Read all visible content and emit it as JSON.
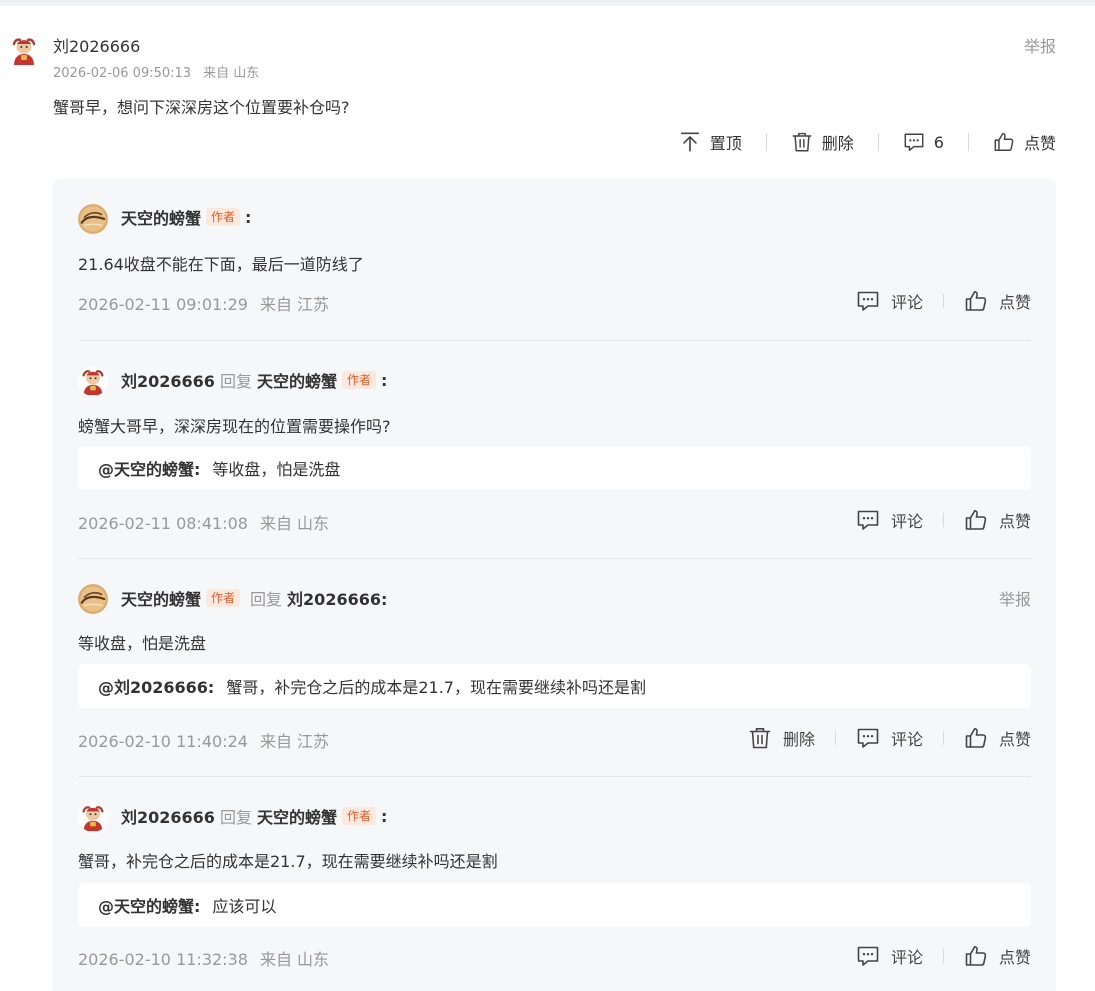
{
  "main": {
    "username": "刘2026666",
    "timestamp": "2026-02-06 09:50:13",
    "location": "来自 山东",
    "report_label": "举报",
    "content": "蟹哥早，想问下深深房这个位置要补仓吗?",
    "actions": {
      "pin_label": "置顶",
      "delete_label": "删除",
      "comment_count": "6",
      "like_label": "点赞"
    }
  },
  "labels": {
    "author_badge": "作者",
    "reply_word": "回复",
    "colon": ":",
    "comment": "评论",
    "like": "点赞",
    "delete": "删除",
    "report": "举报"
  },
  "replies": [
    {
      "user": "天空的螃蟹",
      "is_author": true,
      "content": "21.64收盘不能在下面，最后一道防线了",
      "time": "2026-02-11 09:01:29",
      "location": "来自 江苏"
    },
    {
      "user": "刘2026666",
      "reply_to": "天空的螃蟹",
      "content": "螃蟹大哥早，深深房现在的位置需要操作吗?",
      "quote_user": "@天空的螃蟹:",
      "quote_text": "等收盘，怕是洗盘",
      "time": "2026-02-11 08:41:08",
      "location": "来自 山东"
    },
    {
      "user": "天空的螃蟹",
      "is_author": true,
      "reply_to": "刘2026666:",
      "content": "等收盘，怕是洗盘",
      "quote_user": "@刘2026666:",
      "quote_text": "蟹哥，补完仓之后的成本是21.7，现在需要继续补吗还是割",
      "time": "2026-02-10 11:40:24",
      "location": "来自 江苏"
    },
    {
      "user": "刘2026666",
      "reply_to": "天空的螃蟹",
      "content": "蟹哥，补完仓之后的成本是21.7，现在需要继续补吗还是割",
      "quote_user": "@天空的螃蟹:",
      "quote_text": "应该可以",
      "time": "2026-02-10 11:32:38",
      "location": "来自 山东"
    }
  ],
  "colors": {
    "author_badge_text": "#e25d29",
    "author_badge_bg": "#fbe8df",
    "reply_box_bg": "#f6f7f9",
    "muted_text": "#999999"
  }
}
